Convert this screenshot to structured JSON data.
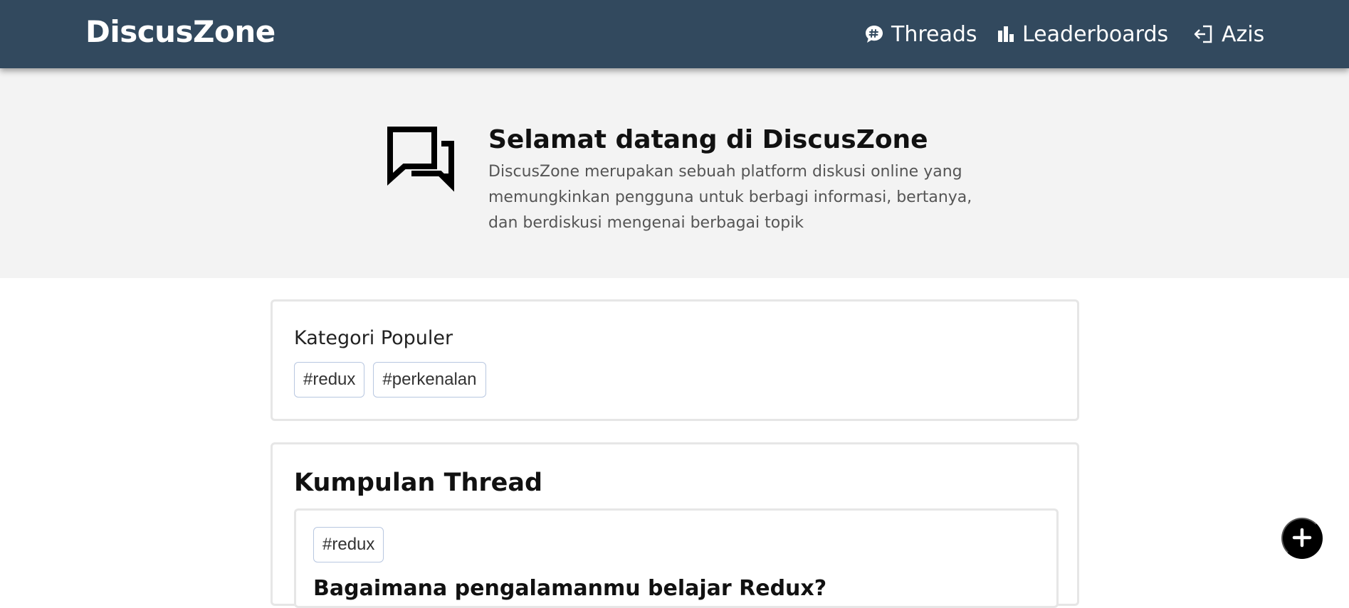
{
  "navbar": {
    "brand": "DiscusZone",
    "items": [
      {
        "label": "Threads",
        "icon": "chat-hash-icon"
      },
      {
        "label": "Leaderboards",
        "icon": "bar-chart-icon"
      },
      {
        "label": "Azis",
        "icon": "login-icon"
      }
    ]
  },
  "hero": {
    "icon": "forum-icon",
    "title": "Selamat datang di DiscusZone",
    "description": "DiscusZone merupakan sebuah platform diskusi online yang memungkinkan pengguna untuk berbagi informasi, bertanya, dan berdiskusi mengenai berbagai topik"
  },
  "popular": {
    "title": "Kategori Populer",
    "categories": [
      "#redux",
      "#perkenalan"
    ]
  },
  "threads": {
    "title": "Kumpulan Thread",
    "items": [
      {
        "category": "#redux",
        "title": "Bagaimana pengalamanmu belajar Redux?"
      }
    ]
  },
  "fab": {
    "icon": "plus-icon"
  },
  "colors": {
    "navbar": "#32495e",
    "hero_bg": "#f3f3f3",
    "chip_border": "#b8c7e0"
  }
}
